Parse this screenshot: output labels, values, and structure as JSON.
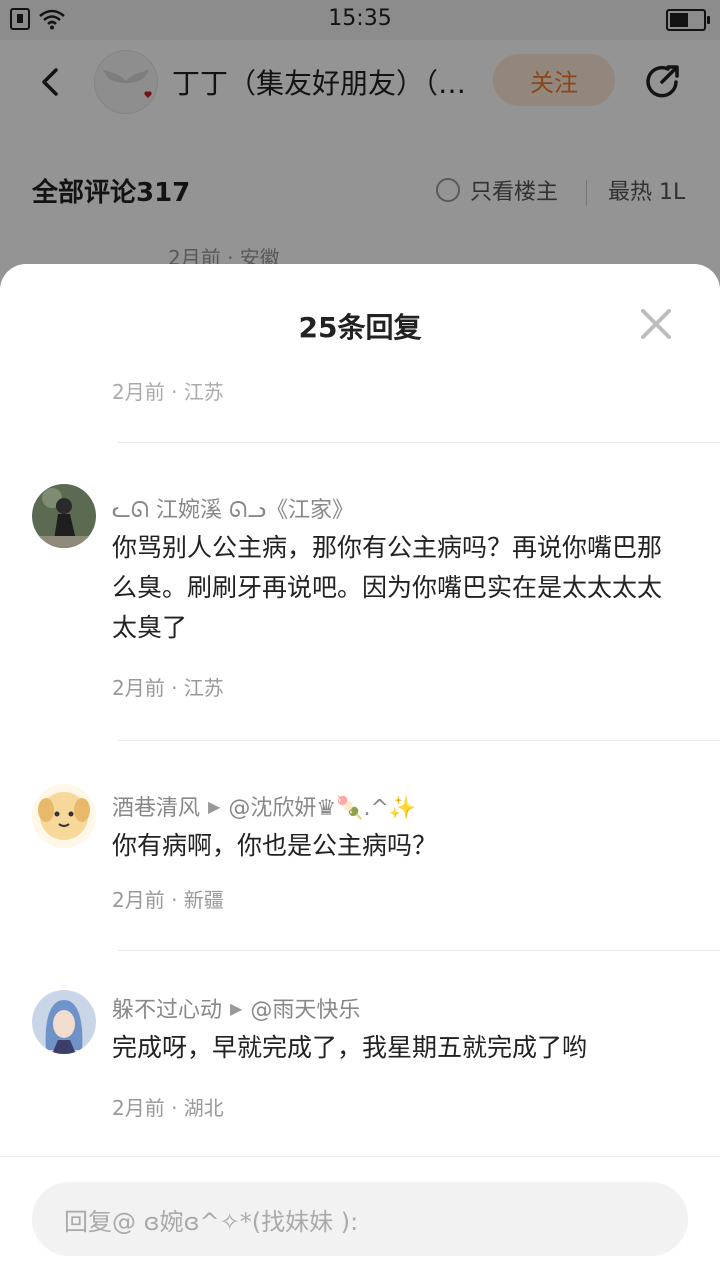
{
  "status_bar": {
    "time": "15:35",
    "battery_level": 0.6
  },
  "header": {
    "title": "丁丁（集友好朋友）（…",
    "follow_label": "关注"
  },
  "comments_head": {
    "all_comments": "全部评论317",
    "only_owner": "只看楼主",
    "sort": "最热 1L"
  },
  "bg_peek_meta": "2月前 · 安徽",
  "sheet": {
    "title": "25条回复",
    "peek_meta": "2月前 · 江苏",
    "replies": [
      {
        "user": "ᓚᘏ 江婉溪 ᘏᓗ《江家》",
        "target": "",
        "text": "你骂别人公主病，那你有公主病吗？再说你嘴巴那么臭。刷刷牙再说吧。因为你嘴巴实在是太太太太太臭了",
        "meta": "2月前 · 江苏"
      },
      {
        "user": "酒巷清风",
        "target": "@沈欣妍♛🍡.^✨",
        "text": "你有病啊，你也是公主病吗？",
        "meta": "2月前 · 新疆"
      },
      {
        "user": "躲不过心动",
        "target": "@雨天快乐",
        "text": "完成呀，早就完成了，我星期五就完成了哟",
        "meta": "2月前 · 湖北"
      }
    ],
    "input_placeholder": "回复@ ɞ婉ɞ^✧*(找妹妹 ):"
  }
}
